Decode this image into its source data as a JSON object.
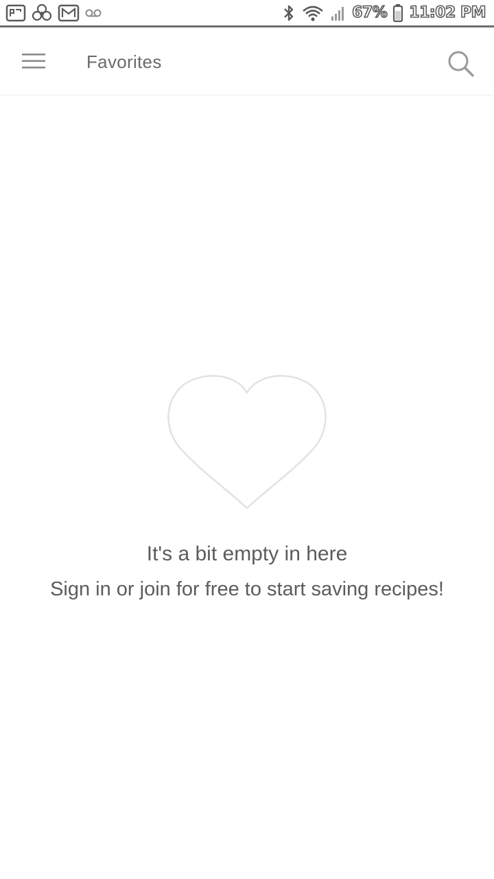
{
  "status_bar": {
    "left_icons": [
      "image-notification-icon",
      "pinwheel-notification-icon",
      "gmail-notification-icon",
      "voicemail-icon"
    ],
    "right_icons": [
      "bluetooth-icon",
      "wifi-icon",
      "signal-icon",
      "battery-icon"
    ],
    "battery": "67%",
    "time": "11:02 PM"
  },
  "app_bar": {
    "title": "Favorites",
    "menu_icon": "hamburger-menu-icon",
    "search_icon": "search-icon"
  },
  "empty_state": {
    "icon": "heart-outline-icon",
    "title": "It's a bit empty in here",
    "subtitle": "Sign in or join for free to start saving recipes!"
  },
  "colors": {
    "background": "#ffffff",
    "text": "#5c5c5c",
    "icon": "#8a8a8a",
    "heart_outline": "#e2e2e2"
  }
}
